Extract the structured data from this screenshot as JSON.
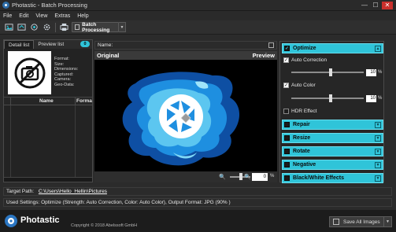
{
  "window": {
    "title": "Photastic - Batch Processing",
    "controls": {
      "minimize": "—",
      "maximize": "☐",
      "close": "✕"
    }
  },
  "menu": [
    "File",
    "Edit",
    "View",
    "Extras",
    "Help"
  ],
  "toolbar": {
    "icons": [
      "add-image-icon",
      "export-icon",
      "camera-icon",
      "settings-icon",
      "print-icon",
      "batch-icon"
    ],
    "batch_label": "Batch Processing",
    "dropdown_glyph": "▼"
  },
  "left_panel": {
    "tabs": [
      "Detail list",
      "Preview list"
    ],
    "count_badge": "0",
    "metadata_labels": [
      "Format:",
      "Size:",
      "Dimensions:",
      "Captured:",
      "Camera:",
      "Geo-Data:"
    ],
    "columns": [
      "Name",
      "Forma"
    ]
  },
  "center": {
    "name_label": "Name:",
    "original_label": "Original",
    "preview_label": "Preview",
    "zoom_out_glyph": "🔍",
    "zoom_in_glyph": "🔍",
    "zoom_value": "0",
    "zoom_unit": "%"
  },
  "right_panel": {
    "optimize": {
      "title": "Optimize",
      "enabled": true,
      "auto_correction_label": "Auto Correction",
      "auto_correction_value": "10",
      "auto_correction_level": 0.55,
      "auto_color_label": "Auto Color",
      "auto_color_value": "10",
      "auto_color_level": 0.55,
      "unit": "%",
      "hdr_label": "HDR Effect"
    },
    "sections": [
      "Repair",
      "Resize",
      "Rotate",
      "Negative",
      "Black/White Effects"
    ]
  },
  "bottom": {
    "target_label": "Target Path:",
    "target_path": "C:\\Users\\Hello_Hellin\\Pictures",
    "settings_text": "Used Settings: Optimize (Strength: Auto Correction, Color: Auto Color), Output Format: JPG (90% )"
  },
  "footer": {
    "brand": "Photastic",
    "copyright": "Copyright © 2018 Abelssoft GmbH",
    "save_label": "Save All Images",
    "dropdown_glyph": "▼"
  },
  "colors": {
    "accent": "#2fc4d9",
    "background": "#2b2b2b",
    "canvas": "#000000"
  }
}
